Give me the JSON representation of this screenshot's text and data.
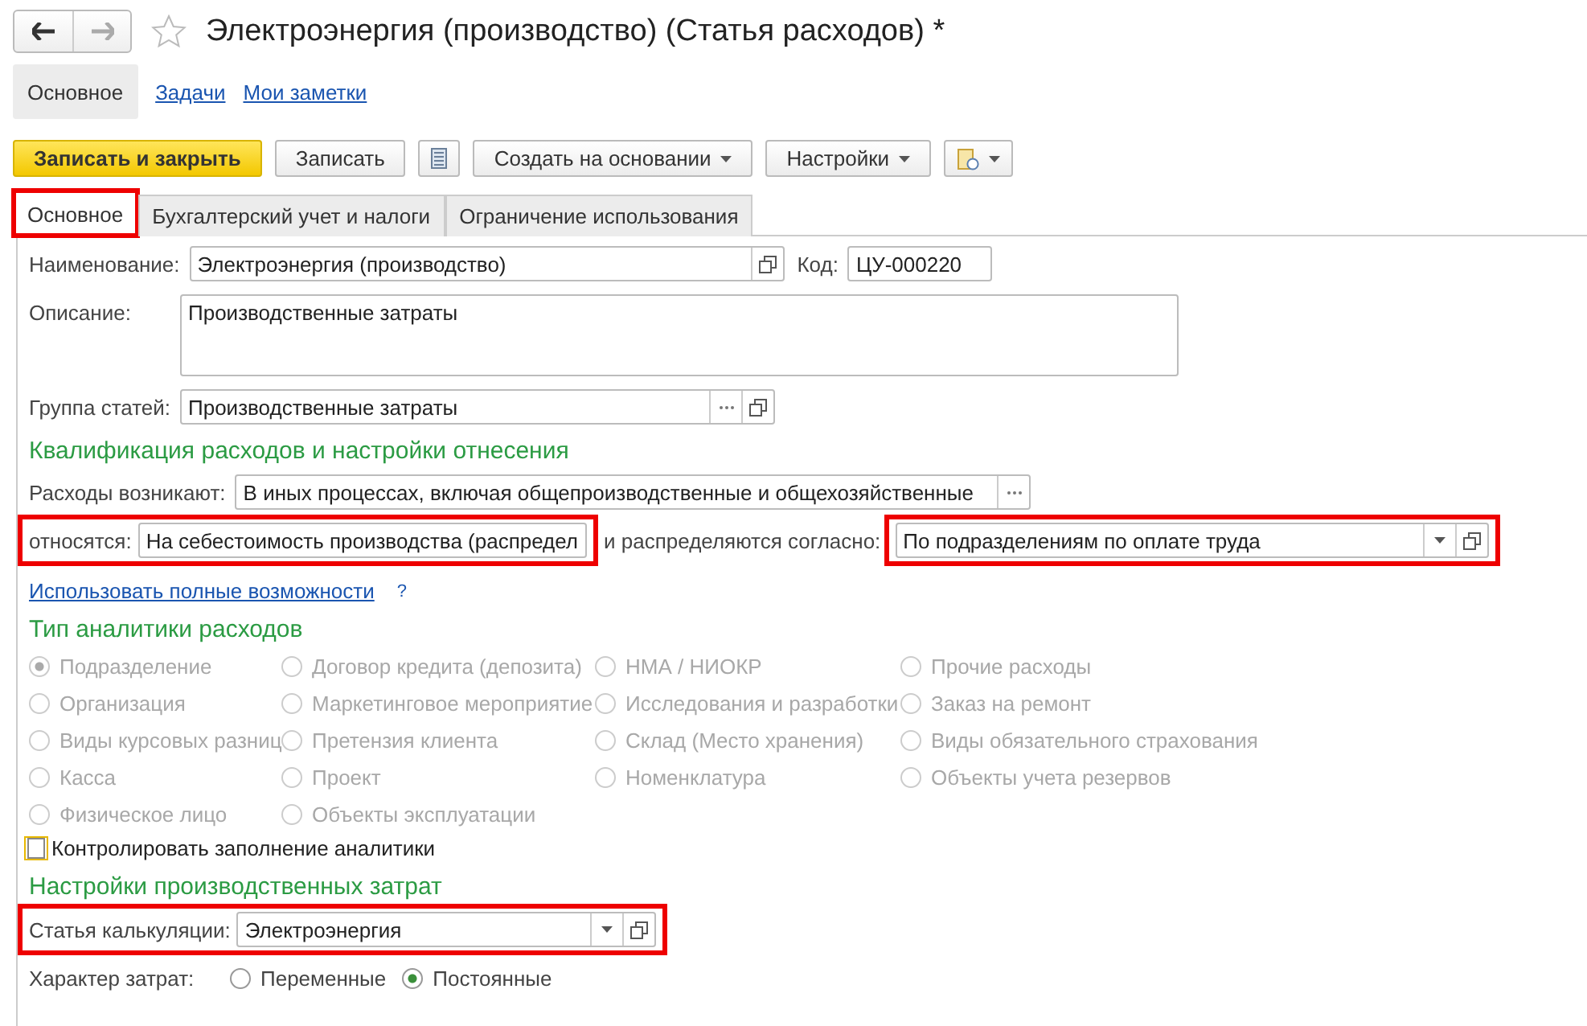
{
  "title": "Электроэнергия (производство) (Статья расходов) *",
  "sections": [
    {
      "label": "Основное",
      "selected": true
    },
    {
      "label": "Задачи",
      "selected": false
    },
    {
      "label": "Мои заметки",
      "selected": false
    }
  ],
  "toolbar": [
    {
      "kind": "primary",
      "label": "Записать и закрыть"
    },
    {
      "kind": "plain",
      "label": "Записать"
    },
    {
      "kind": "list-icon"
    },
    {
      "kind": "menu",
      "label": "Создать на основании"
    },
    {
      "kind": "menu",
      "label": "Настройки"
    },
    {
      "kind": "report-menu"
    }
  ],
  "tabs": [
    {
      "label": "Основное",
      "selected": true,
      "highlighted": true
    },
    {
      "label": "Бухгалтерский учет и налоги",
      "selected": false,
      "highlighted": false
    },
    {
      "label": "Ограничение использования",
      "selected": false,
      "highlighted": false
    }
  ],
  "name": {
    "label": "Наименование:",
    "value": "Электроэнергия (производство)"
  },
  "code": {
    "label": "Код:",
    "value": "ЦУ-000220"
  },
  "description": {
    "label": "Описание:",
    "value": "Производственные затраты"
  },
  "group": {
    "label": "Группа статей:",
    "value": "Производственные затраты"
  },
  "qualification_heading": "Квалификация расходов и настройки отнесения",
  "arises": {
    "label": "Расходы возникают:",
    "value": "В иных процессах, включая общепроизводственные и общехозяйственные"
  },
  "attributed": {
    "label": "относятся:",
    "value": "На себестоимость производства (распредел",
    "highlighted": true
  },
  "distributed": {
    "label": "и распределяются согласно:",
    "value": "По подразделениям по оплате труда",
    "highlighted": true
  },
  "full_link": {
    "text": "Использовать полные возможности",
    "help": "?"
  },
  "analytics_heading": "Тип аналитики расходов",
  "analytics": [
    {
      "label": "Подразделение",
      "selected": true
    },
    {
      "label": "Договор кредита (депозита)",
      "selected": false
    },
    {
      "label": "НМА / НИОКР",
      "selected": false
    },
    {
      "label": "Прочие расходы",
      "selected": false
    },
    {
      "label": "Организация",
      "selected": false
    },
    {
      "label": "Маркетинговое мероприятие",
      "selected": false
    },
    {
      "label": "Исследования и разработки",
      "selected": false
    },
    {
      "label": "Заказ на ремонт",
      "selected": false
    },
    {
      "label": "Виды курсовых разниц",
      "selected": false
    },
    {
      "label": "Претензия клиента",
      "selected": false
    },
    {
      "label": "Склад (Место хранения)",
      "selected": false
    },
    {
      "label": "Виды обязательного страхования",
      "selected": false
    },
    {
      "label": "Касса",
      "selected": false
    },
    {
      "label": "Проект",
      "selected": false
    },
    {
      "label": "Номенклатура",
      "selected": false
    },
    {
      "label": "Объекты учета резервов",
      "selected": false
    },
    {
      "label": "Физическое лицо",
      "selected": false
    },
    {
      "label": "Объекты эксплуатации",
      "selected": false
    }
  ],
  "analytics_disabled": true,
  "control_check": {
    "label": "Контролировать заполнение аналитики",
    "checked": false
  },
  "production_heading": "Настройки производственных затрат",
  "cost_item": {
    "label": "Статья калькуляции:",
    "value": "Электроэнергия",
    "highlighted": true
  },
  "cost_nature": {
    "label": "Характер затрат:",
    "options": [
      {
        "label": "Переменные",
        "selected": false
      },
      {
        "label": "Постоянные",
        "selected": true
      }
    ]
  }
}
